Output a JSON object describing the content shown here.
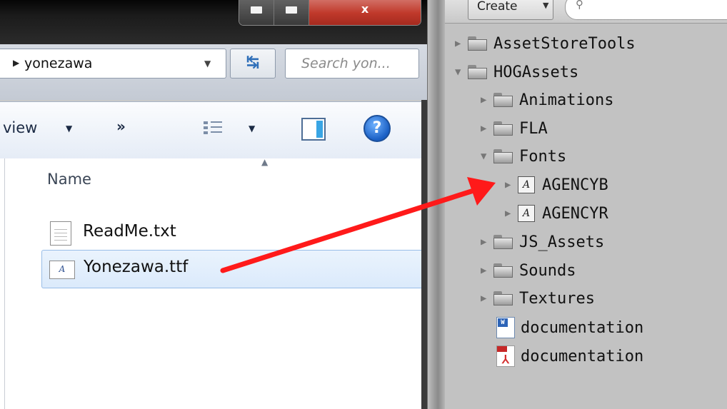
{
  "explorer": {
    "window_controls": {
      "close_label": "x"
    },
    "address": {
      "crumb": "yonezawa"
    },
    "search": {
      "placeholder": "Search yon..."
    },
    "toolbar": {
      "view_label": "view",
      "more_label": "»",
      "help_label": "?"
    },
    "columns": {
      "name": "Name"
    },
    "files": [
      {
        "name": "ReadMe.txt",
        "icon": "text-file-icon"
      },
      {
        "name": "Yonezawa.ttf",
        "icon": "font-file-icon",
        "selected": true
      }
    ]
  },
  "project": {
    "create_label": "Create",
    "search_icon": "search-icon",
    "font_glyph": "A",
    "tree": [
      {
        "label": "AssetStoreTools",
        "type": "folder",
        "expanded": false
      },
      {
        "label": "HOGAssets",
        "type": "folder",
        "expanded": true
      },
      {
        "label": "Animations",
        "type": "folder",
        "expanded": false
      },
      {
        "label": "FLA",
        "type": "folder",
        "expanded": false
      },
      {
        "label": "Fonts",
        "type": "folder",
        "expanded": true
      },
      {
        "label": "AGENCYB",
        "type": "font",
        "expanded": false
      },
      {
        "label": "AGENCYR",
        "type": "font",
        "expanded": false
      },
      {
        "label": "JS_Assets",
        "type": "folder",
        "expanded": false
      },
      {
        "label": "Sounds",
        "type": "folder",
        "expanded": false
      },
      {
        "label": "Textures",
        "type": "folder",
        "expanded": false
      },
      {
        "label": "documentation",
        "type": "word-document"
      },
      {
        "label": "documentation",
        "type": "pdf-document"
      }
    ]
  },
  "colors": {
    "arrow": "#ff1a1a",
    "selection": "#dbeafb",
    "panel": "#c2c2c2"
  }
}
